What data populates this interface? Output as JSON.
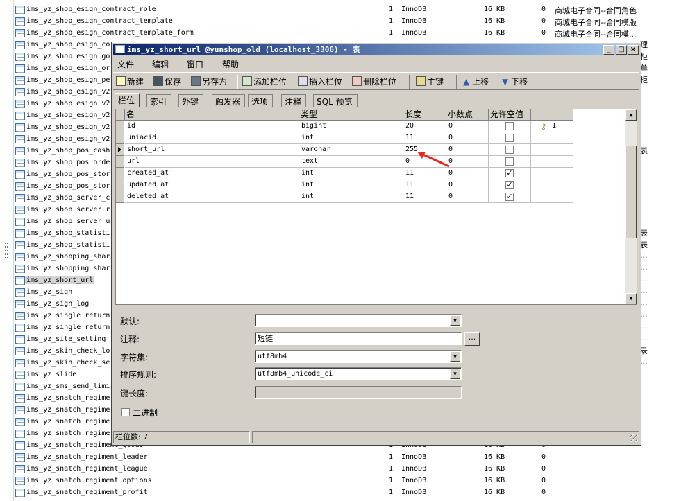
{
  "background": {
    "rows": [
      {
        "name": "ims_yz_shop_esign_contract_role",
        "c1": "1",
        "c2": "InnoDB",
        "c3": "16 KB",
        "c4": "0",
        "c5": "商城电子合同--合同角色"
      },
      {
        "name": "ims_yz_shop_esign_contract_template",
        "c1": "1",
        "c2": "InnoDB",
        "c3": "16 KB",
        "c4": "0",
        "c5": "商城电子合同--合同模版"
      },
      {
        "name": "ims_yz_shop_esign_contract_template_form",
        "c1": "1",
        "c2": "InnoDB",
        "c3": "16 KB",
        "c4": "0",
        "c5": "商城电子合同--合同模..."
      },
      {
        "name": "ims_yz_shop_esign_co",
        "c1": "",
        "c2": "",
        "c3": "",
        "c4": "",
        "c5": ""
      },
      {
        "name": "ims_yz_shop_esign_go",
        "c1": "",
        "c2": "",
        "c3": "",
        "c4": "",
        "c5": ""
      },
      {
        "name": "ims_yz_shop_esign_or",
        "c1": "",
        "c2": "",
        "c3": "",
        "c4": "",
        "c5": ""
      },
      {
        "name": "ims_yz_shop_esign_pe",
        "c1": "",
        "c2": "",
        "c3": "",
        "c4": "",
        "c5": ""
      },
      {
        "name": "ims_yz_shop_esign_v2",
        "c1": "",
        "c2": "",
        "c3": "",
        "c4": "",
        "c5": ""
      },
      {
        "name": "ims_yz_shop_esign_v2",
        "c1": "",
        "c2": "",
        "c3": "",
        "c4": "",
        "c5": ""
      },
      {
        "name": "ims_yz_shop_esign_v2",
        "c1": "",
        "c2": "",
        "c3": "",
        "c4": "",
        "c5": ""
      },
      {
        "name": "ims_yz_shop_esign_v2",
        "c1": "",
        "c2": "",
        "c3": "",
        "c4": "",
        "c5": ""
      },
      {
        "name": "ims_yz_shop_esign_v2",
        "c1": "",
        "c2": "",
        "c3": "",
        "c4": "",
        "c5": ""
      },
      {
        "name": "ims_yz_shop_pos_cash",
        "c1": "",
        "c2": "",
        "c3": "",
        "c4": "",
        "c5": ""
      },
      {
        "name": "ims_yz_shop_pos_orde",
        "c1": "",
        "c2": "",
        "c3": "",
        "c4": "",
        "c5": ""
      },
      {
        "name": "ims_yz_shop_pos_stor",
        "c1": "",
        "c2": "",
        "c3": "",
        "c4": "",
        "c5": ""
      },
      {
        "name": "ims_yz_shop_pos_stor",
        "c1": "",
        "c2": "",
        "c3": "",
        "c4": "",
        "c5": ""
      },
      {
        "name": "ims_yz_shop_server_c",
        "c1": "",
        "c2": "",
        "c3": "",
        "c4": "",
        "c5": ""
      },
      {
        "name": "ims_yz_shop_server_r",
        "c1": "",
        "c2": "",
        "c3": "",
        "c4": "",
        "c5": ""
      },
      {
        "name": "ims_yz_shop_server_u",
        "c1": "",
        "c2": "",
        "c3": "",
        "c4": "",
        "c5": ""
      },
      {
        "name": "ims_yz_shop_statisti",
        "c1": "",
        "c2": "",
        "c3": "",
        "c4": "",
        "c5": ""
      },
      {
        "name": "ims_yz_shop_statisti",
        "c1": "",
        "c2": "",
        "c3": "",
        "c4": "",
        "c5": ""
      },
      {
        "name": "ims_yz_shopping_shar",
        "c1": "",
        "c2": "",
        "c3": "",
        "c4": "",
        "c5": ""
      },
      {
        "name": "ims_yz_shopping_shar",
        "c1": "",
        "c2": "",
        "c3": "",
        "c4": "",
        "c5": ""
      },
      {
        "name": "ims_yz_short_url",
        "c1": "",
        "c2": "",
        "c3": "",
        "c4": "",
        "c5": ""
      },
      {
        "name": "ims_yz_sign",
        "c1": "",
        "c2": "",
        "c3": "",
        "c4": "",
        "c5": ""
      },
      {
        "name": "ims_yz_sign_log",
        "c1": "",
        "c2": "",
        "c3": "",
        "c4": "",
        "c5": ""
      },
      {
        "name": "ims_yz_single_return",
        "c1": "",
        "c2": "",
        "c3": "",
        "c4": "",
        "c5": ""
      },
      {
        "name": "ims_yz_single_return",
        "c1": "",
        "c2": "",
        "c3": "",
        "c4": "",
        "c5": ""
      },
      {
        "name": "ims_yz_site_setting",
        "c1": "",
        "c2": "",
        "c3": "",
        "c4": "",
        "c5": ""
      },
      {
        "name": "ims_yz_skin_check_lo",
        "c1": "",
        "c2": "",
        "c3": "",
        "c4": "",
        "c5": ""
      },
      {
        "name": "ims_yz_skin_check_se",
        "c1": "",
        "c2": "",
        "c3": "",
        "c4": "",
        "c5": ""
      },
      {
        "name": "ims_yz_slide",
        "c1": "",
        "c2": "",
        "c3": "",
        "c4": "",
        "c5": ""
      },
      {
        "name": "ims_yz_sms_send_limi",
        "c1": "",
        "c2": "",
        "c3": "",
        "c4": "",
        "c5": ""
      },
      {
        "name": "ims_yz_snatch_regime",
        "c1": "",
        "c2": "",
        "c3": "",
        "c4": "",
        "c5": ""
      },
      {
        "name": "ims_yz_snatch_regime",
        "c1": "",
        "c2": "",
        "c3": "",
        "c4": "",
        "c5": ""
      },
      {
        "name": "ims_yz_snatch_regime",
        "c1": "",
        "c2": "",
        "c3": "",
        "c4": "",
        "c5": ""
      },
      {
        "name": "ims_yz_snatch_regime",
        "c1": "",
        "c2": "",
        "c3": "",
        "c4": "",
        "c5": ""
      },
      {
        "name": "ims_yz_snatch_regiment_goods",
        "c1": "1",
        "c2": "InnoDB",
        "c3": "16 KB",
        "c4": "0",
        "c5": ""
      },
      {
        "name": "ims_yz_snatch_regiment_leader",
        "c1": "1",
        "c2": "InnoDB",
        "c3": "16 KB",
        "c4": "0",
        "c5": ""
      },
      {
        "name": "ims_yz_snatch_regiment_league",
        "c1": "1",
        "c2": "InnoDB",
        "c3": "16 KB",
        "c4": "0",
        "c5": ""
      },
      {
        "name": "ims_yz_snatch_regiment_options",
        "c1": "1",
        "c2": "InnoDB",
        "c3": "16 KB",
        "c4": "0",
        "c5": ""
      },
      {
        "name": "ims_yz_snatch_regiment_profit",
        "c1": "1",
        "c2": "InnoDB",
        "c3": "16 KB",
        "c4": "0",
        "c5": ""
      }
    ],
    "selected_index": 23,
    "right_fragments": [
      "理",
      "柜",
      "单",
      "柜",
      "表",
      "表",
      "表",
      "...",
      "...",
      "...",
      "...",
      "...",
      "...",
      "...",
      "...",
      "录",
      "..."
    ]
  },
  "window": {
    "title": "ims_yz_short_url @yunshop_old (localhost_3306) - 表",
    "buttons": {
      "minimize": "_",
      "maximize": "□",
      "close": "×"
    },
    "menu": [
      "文件",
      "编辑",
      "窗口",
      "帮助"
    ],
    "toolbar": {
      "new": "新建",
      "save": "保存",
      "save_as": "另存为",
      "add_field": "添加栏位",
      "insert_field": "插入栏位",
      "delete_field": "删除栏位",
      "primary_key": "主键",
      "move_up": "上移",
      "move_down": "下移"
    },
    "tabs": [
      "栏位",
      "索引",
      "外键",
      "触发器",
      "选项",
      "注释",
      "SQL 预览"
    ],
    "grid": {
      "headers": [
        "名",
        "类型",
        "长度",
        "小数点",
        "允许空值",
        ""
      ],
      "rows": [
        {
          "name": "id",
          "type": "bigint",
          "length": "20",
          "decimals": "0",
          "nullable": false,
          "key": "1"
        },
        {
          "name": "uniacid",
          "type": "int",
          "length": "11",
          "decimals": "0",
          "nullable": false,
          "key": ""
        },
        {
          "name": "short_url",
          "type": "varchar",
          "length": "255",
          "decimals": "0",
          "nullable": false,
          "key": ""
        },
        {
          "name": "url",
          "type": "text",
          "length": "0",
          "decimals": "0",
          "nullable": false,
          "key": ""
        },
        {
          "name": "created_at",
          "type": "int",
          "length": "11",
          "decimals": "0",
          "nullable": true,
          "key": ""
        },
        {
          "name": "updated_at",
          "type": "int",
          "length": "11",
          "decimals": "0",
          "nullable": true,
          "key": ""
        },
        {
          "name": "deleted_at",
          "type": "int",
          "length": "11",
          "decimals": "0",
          "nullable": true,
          "key": ""
        }
      ],
      "current_row": 2
    },
    "props": {
      "default_label": "默认:",
      "default_value": "",
      "comment_label": "注释:",
      "comment_value": "短链",
      "ellipsis": "...",
      "charset_label": "字符集:",
      "charset_value": "utf8mb4",
      "collation_label": "排序规则:",
      "collation_value": "utf8mb4_unicode_ci",
      "keylen_label": "键长度:",
      "keylen_value": "",
      "binary_label": "二进制"
    },
    "status": "栏位数: 7",
    "colors": {
      "title_start": "#0a246a",
      "title_end": "#a6caf0",
      "arrow": "#e8281c",
      "face": "#d4d0c8"
    }
  }
}
